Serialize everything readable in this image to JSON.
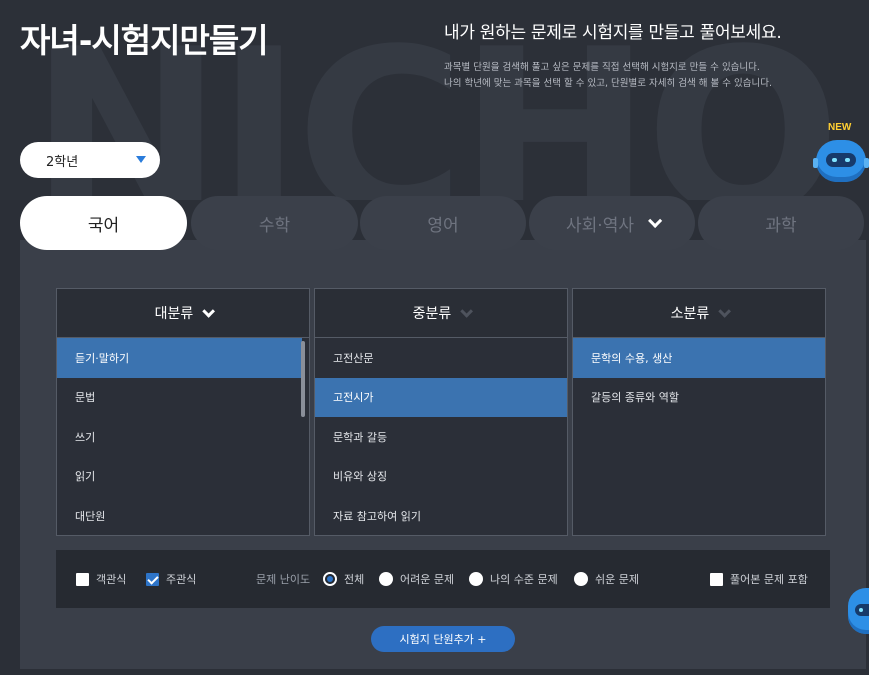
{
  "header": {
    "title": "자녀-시험지만들기",
    "headline": "내가 원하는 문제로 시험지를 만들고 풀어보세요.",
    "desc_line1": "과목별 단원을 검색해 풀고 싶은 문제를 직접 선택해 시험지로 만들 수 있습니다.",
    "desc_line2": "나의 학년에 맞는 과목을 선택 할 수 있고, 단원별로 자세히 검색 해 볼 수 있습니다."
  },
  "grade_select": {
    "value": "2학년"
  },
  "robot": {
    "badge": "NEW"
  },
  "tabs": [
    {
      "label": "국어",
      "active": true
    },
    {
      "label": "수학",
      "active": false
    },
    {
      "label": "영어",
      "active": false
    },
    {
      "label": "사회·역사",
      "active": false
    },
    {
      "label": "과학",
      "active": false
    }
  ],
  "columns": {
    "major": {
      "header": "대분류",
      "items": [
        "듣기·말하기",
        "문법",
        "쓰기",
        "읽기",
        "대단원"
      ],
      "selected_index": 0
    },
    "middle": {
      "header": "중분류",
      "items": [
        "고전산문",
        "고전시가",
        "문학과 갈등",
        "비유와 상징",
        "자료 참고하여 읽기"
      ],
      "selected_index": 1
    },
    "minor": {
      "header": "소분류",
      "items": [
        "문학의 수용, 생산",
        "갈등의 종류와 역할"
      ],
      "selected_index": 0
    }
  },
  "options": {
    "objective_label": "객관식",
    "subjective_label": "주관식",
    "difficulty_label": "문제 난이도",
    "difficulty_all": "전체",
    "difficulty_hard": "어려운 문제",
    "difficulty_mine": "나의 수준 문제",
    "difficulty_easy": "쉬운 문제",
    "include_solved_label": "풀어본 문제 포함"
  },
  "add_button": {
    "label": "시험지 단원추가 +"
  },
  "colors": {
    "accent": "#2d74c8",
    "selected_row": "#3b73b0",
    "background": "#2b2f37"
  }
}
